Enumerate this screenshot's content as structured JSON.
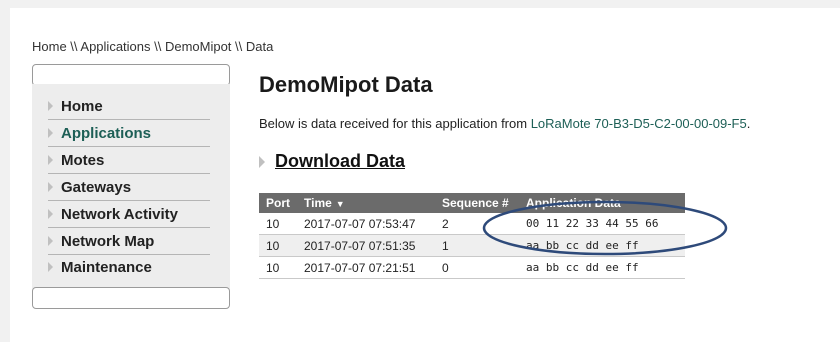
{
  "breadcrumb": "Home \\\\ Applications \\\\ DemoMipot \\\\ Data",
  "sidebar": {
    "items": [
      {
        "label": "Home"
      },
      {
        "label": "Applications"
      },
      {
        "label": "Motes"
      },
      {
        "label": "Gateways"
      },
      {
        "label": "Network Activity"
      },
      {
        "label": "Network Map"
      },
      {
        "label": "Maintenance"
      }
    ],
    "active": "Applications"
  },
  "main": {
    "title": "DemoMipot Data",
    "intro_prefix": "Below is data received for this application from ",
    "intro_link": "LoRaMote 70-B3-D5-C2-00-00-09-F5",
    "intro_suffix": ".",
    "download_label": "Download Data"
  },
  "table": {
    "headers": [
      "Port",
      "Time",
      "Sequence #",
      "Application Data"
    ],
    "sort_indicator": "▼",
    "rows": [
      {
        "port": "10",
        "time": "2017-07-07 07:53:47",
        "seq": "2",
        "data": "00 11 22 33 44 55 66"
      },
      {
        "port": "10",
        "time": "2017-07-07 07:51:35",
        "seq": "1",
        "data": "aa bb cc dd ee ff"
      },
      {
        "port": "10",
        "time": "2017-07-07 07:21:51",
        "seq": "0",
        "data": "aa bb cc dd ee ff"
      }
    ]
  },
  "colors": {
    "accent": "#1d5f56",
    "header_bg": "#6b6b6b",
    "annotation_ellipse": "#2e4a7a"
  }
}
